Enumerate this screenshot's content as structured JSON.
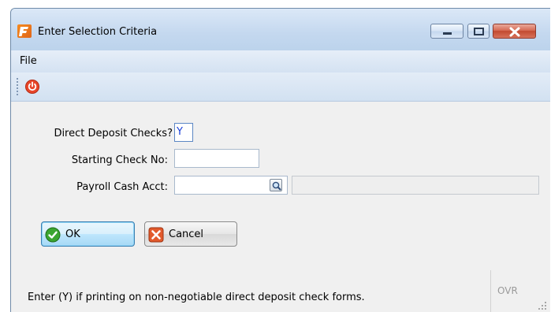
{
  "window": {
    "title": "Enter Selection Criteria",
    "app_icon": "app-logo-icon",
    "controls": [
      "minimize-icon",
      "maximize-icon",
      "close-icon"
    ]
  },
  "menu": {
    "file_label": "File"
  },
  "toolbar": {
    "exit_icon": "power-icon"
  },
  "form": {
    "direct_deposit": {
      "label": "Direct Deposit Checks?",
      "value": "Y"
    },
    "starting_check": {
      "label": "Starting Check No:",
      "value": ""
    },
    "payroll_cash": {
      "label": "Payroll Cash Acct:",
      "value": "",
      "description": ""
    }
  },
  "buttons": {
    "ok_label": "OK",
    "cancel_label": "Cancel"
  },
  "status": {
    "message": "Enter (Y) if printing on non-negotiable direct deposit check forms.",
    "mode": "OVR"
  },
  "colors": {
    "title_gradient_top": "#dbe8f7",
    "content_bg": "#f0f0f0",
    "close_button": "#c24a30",
    "input_text": "#1a3fd8"
  }
}
